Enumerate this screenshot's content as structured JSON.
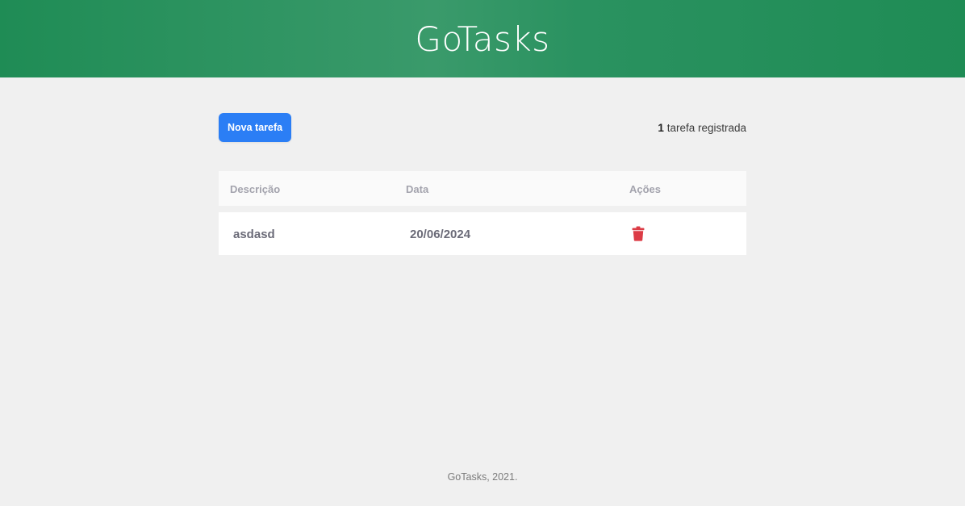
{
  "header": {
    "title": "GoTasks"
  },
  "toolbar": {
    "new_task_label": "Nova tarefa",
    "task_count": "1",
    "task_count_suffix": " tarefa registrada"
  },
  "table": {
    "columns": [
      "Descrição",
      "Data",
      "Ações"
    ],
    "rows": [
      {
        "description": "asdasd",
        "date": "20/06/2024",
        "action_icon": "trash-icon"
      }
    ]
  },
  "footer": {
    "text": "GoTasks, 2021."
  },
  "colors": {
    "header_green": "#2a9260",
    "primary_blue": "#2b7ef5",
    "danger_red": "#dc3b45",
    "background": "#f0f0f0"
  }
}
